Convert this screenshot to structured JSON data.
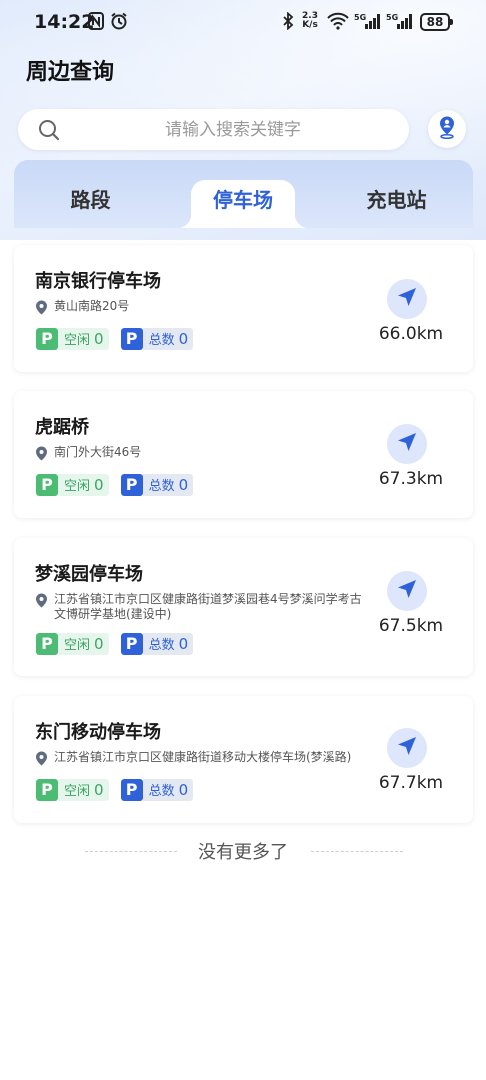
{
  "status_bar": {
    "time": "14:22",
    "network_speed_value": "2.3",
    "network_speed_unit": "K/s",
    "battery": "88"
  },
  "header": {
    "title": "周边查询"
  },
  "search": {
    "placeholder": "请输入搜索关键字"
  },
  "tabs": [
    {
      "label": "路段",
      "active": false
    },
    {
      "label": "停车场",
      "active": true
    },
    {
      "label": "充电站",
      "active": false
    }
  ],
  "parking_lots": [
    {
      "name": "南京银行停车场",
      "address": "黄山南路20号",
      "free_label": "空闲",
      "free": "0",
      "total_label": "总数",
      "total": "0",
      "distance": "66.0km"
    },
    {
      "name": "虎踞桥",
      "address": "南门外大街46号",
      "free_label": "空闲",
      "free": "0",
      "total_label": "总数",
      "total": "0",
      "distance": "67.3km"
    },
    {
      "name": "梦溪园停车场",
      "address": "江苏省镇江市京口区健康路街道梦溪园巷4号梦溪问学考古文博研学基地(建设中)",
      "free_label": "空闲",
      "free": "0",
      "total_label": "总数",
      "total": "0",
      "distance": "67.5km"
    },
    {
      "name": "东门移动停车场",
      "address": "江苏省镇江市京口区健康路街道移动大楼停车场(梦溪路)",
      "free_label": "空闲",
      "free": "0",
      "total_label": "总数",
      "total": "0",
      "distance": "67.7km"
    }
  ],
  "list_end_text": "没有更多了",
  "icons": {
    "parking_badge_glyph": "P",
    "search": "search-icon",
    "location": "location-person-icon",
    "navigate": "navigation-arrow-icon",
    "pin": "map-pin-icon"
  },
  "colors": {
    "accent": "#2f62d9",
    "free_green": "#4cbb73",
    "nav_circle": "#dde6fb"
  }
}
